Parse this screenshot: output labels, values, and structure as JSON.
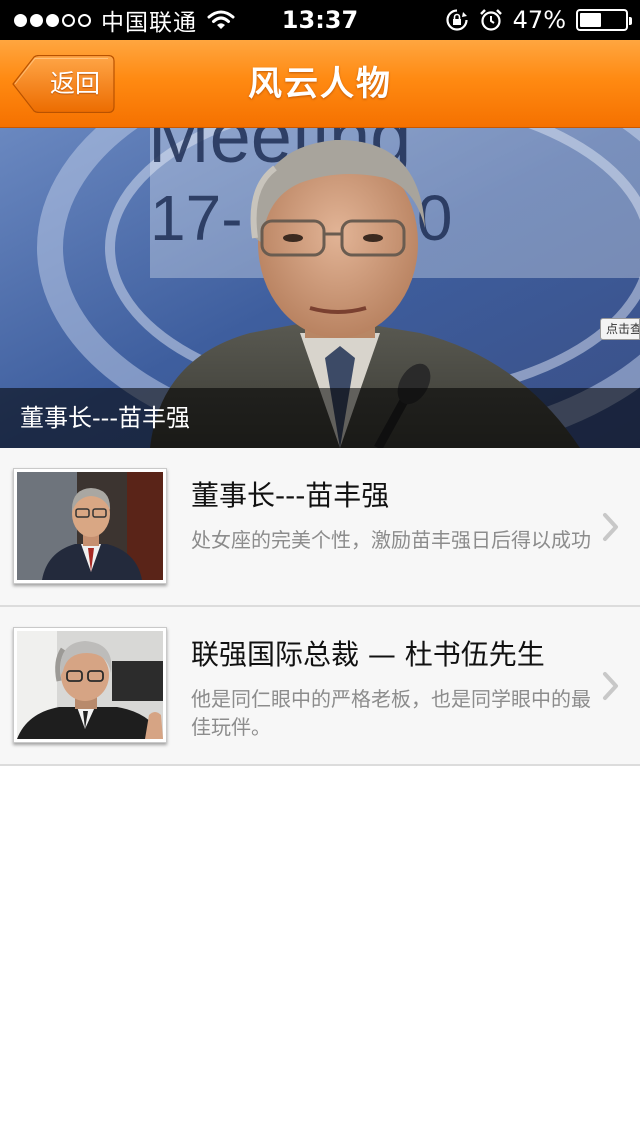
{
  "status_bar": {
    "carrier": "中国联通",
    "time": "13:37",
    "battery": "47%",
    "battery_level": 0.47,
    "icons": [
      "signal-dots-icon",
      "wifi-icon",
      "orientation-lock-icon",
      "alarm-icon",
      "battery-icon"
    ]
  },
  "nav": {
    "back_label": "返回",
    "title": "风云人物",
    "accent_color": "#ff8a12"
  },
  "banner": {
    "caption": "董事长---苗丰强",
    "tag_text": "点击查"
  },
  "list": {
    "items": [
      {
        "title": "董事长---苗丰强",
        "desc": "处女座的完美个性，激励苗丰强日后得以成功"
      },
      {
        "title": "联强国际总裁 — 杜书伍先生",
        "desc": "他是同仁眼中的严格老板，也是同学眼中的最佳玩伴。"
      }
    ]
  }
}
